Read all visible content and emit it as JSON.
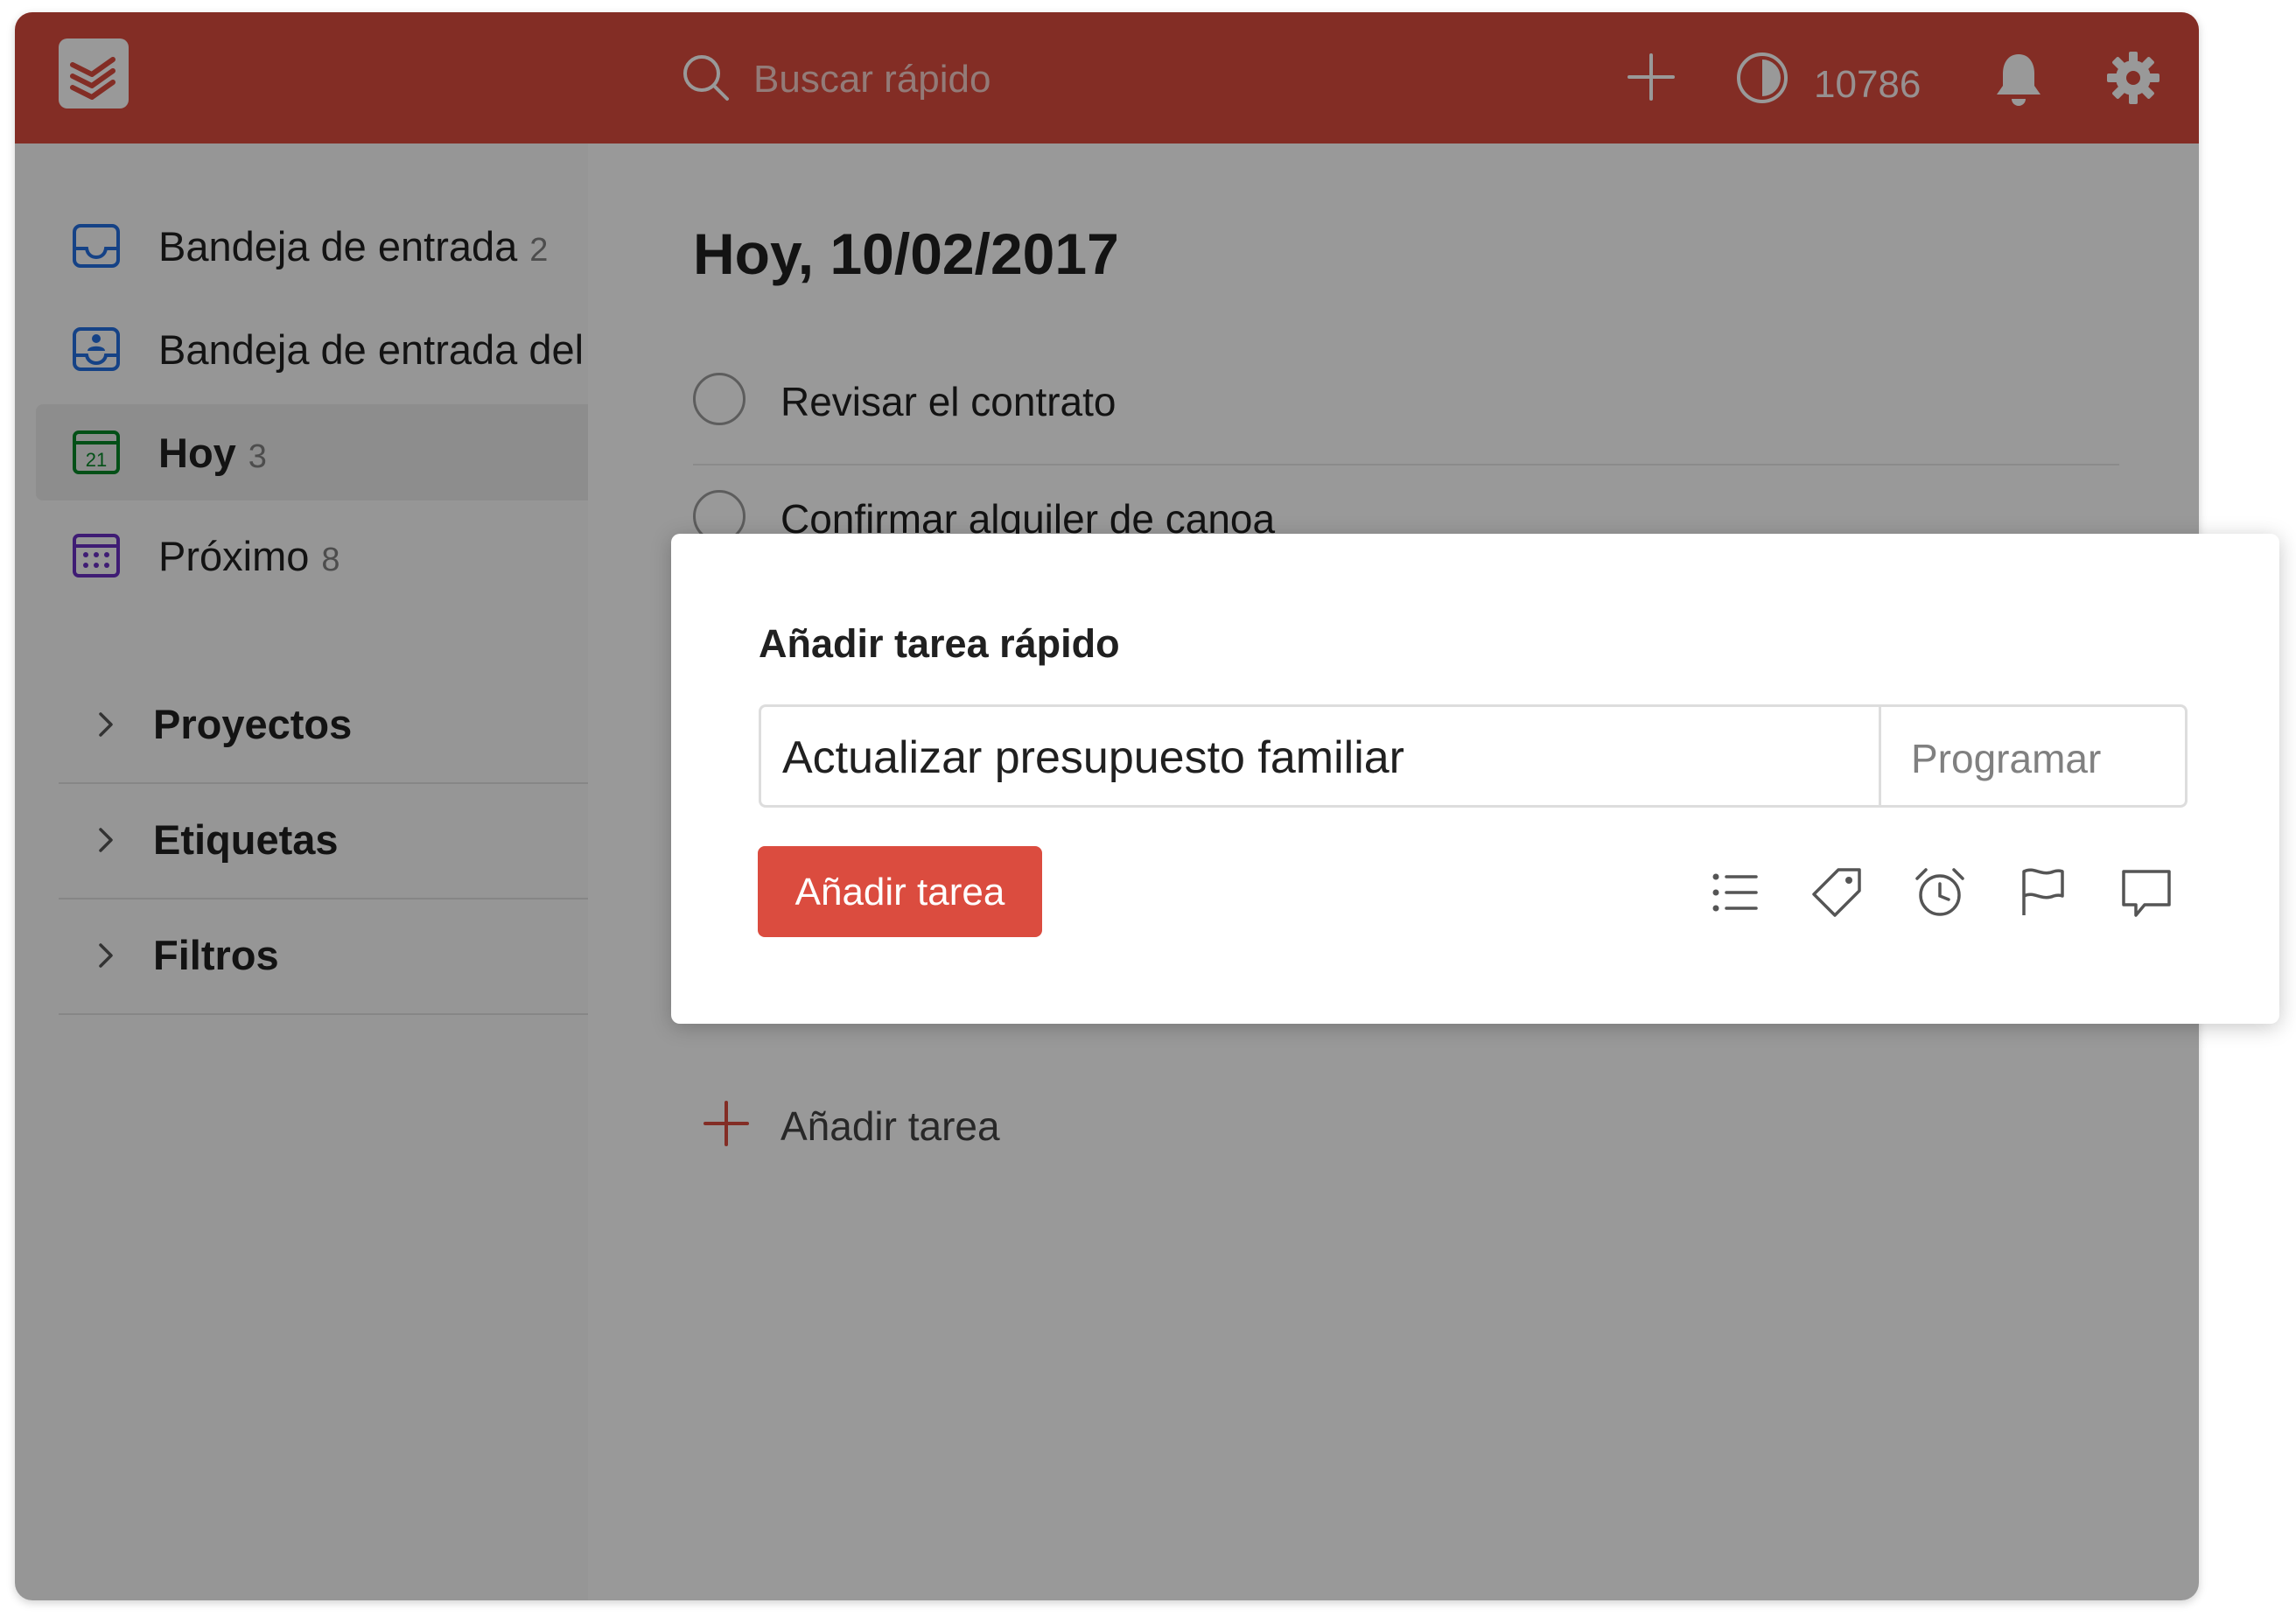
{
  "header": {
    "search_placeholder": "Buscar rápido",
    "karma": "10786"
  },
  "sidebar": {
    "items": [
      {
        "label": "Bandeja de entrada",
        "count": "2"
      },
      {
        "label": "Bandeja de entrada del e",
        "count": ""
      },
      {
        "label": "Hoy",
        "count": "3"
      },
      {
        "label": "Próximo",
        "count": "8"
      }
    ],
    "sections": [
      {
        "label": "Proyectos"
      },
      {
        "label": "Etiquetas"
      },
      {
        "label": "Filtros"
      }
    ]
  },
  "main": {
    "title": "Hoy, 10/02/2017",
    "tasks": [
      {
        "label": "Revisar el contrato"
      },
      {
        "label": "Confirmar alquiler de canoa"
      }
    ],
    "add_task_label": "Añadir tarea"
  },
  "quick_add": {
    "title": "Añadir tarea rápido",
    "input_value": "Actualizar presupuesto familiar",
    "schedule_label": "Programar",
    "add_button_label": "Añadir tarea"
  },
  "colors": {
    "brand": "#db4c3f",
    "calendar_today_icon": "#058527",
    "inbox_icon": "#246fe0"
  },
  "icons": {
    "logo": "todoist-logo-icon",
    "search": "search-icon",
    "add": "plus-icon",
    "karma": "karma-icon",
    "notifications": "bell-icon",
    "settings": "gear-icon",
    "project": "list-icon",
    "labels": "tag-icon",
    "reminders": "alarm-clock-icon",
    "priority": "flag-icon",
    "comments": "comment-icon"
  }
}
